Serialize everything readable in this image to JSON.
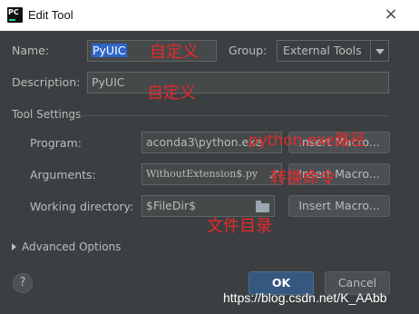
{
  "window": {
    "title": "Edit Tool",
    "app_icon_text": "PC",
    "close_glyph": "×"
  },
  "form": {
    "name_label": "Name:",
    "name_value": "PyUIC",
    "group_label": "Group:",
    "group_value": "External Tools",
    "description_label": "Description:",
    "description_value": "PyUIC"
  },
  "tool_settings": {
    "section_label": "Tool Settings",
    "program_label": "Program:",
    "program_value": "aconda3\\python.exe",
    "arguments_label": "Arguments:",
    "arguments_value": "WithoutExtension$.py",
    "working_dir_label": "Working directory:",
    "working_dir_value": "$FileDir$",
    "insert_macro_label": "Insert Macro..."
  },
  "advanced": {
    "label": "Advanced Options"
  },
  "footer": {
    "help_glyph": "?",
    "ok_label": "OK",
    "cancel_label": "Cancel"
  },
  "annotations": {
    "name_note": "自定义",
    "description_note": "自定义",
    "program_note": "python.exe路径",
    "arguments_note": "转换命令",
    "working_dir_note": "文件目录",
    "watermark": "https://blog.csdn.net/K_AAbb"
  },
  "icons": {
    "app": "pycharm-logo-icon",
    "close": "close-icon",
    "combo": "chevron-down-icon",
    "folder": "folder-icon",
    "expand": "expand-arrows-icon",
    "advanced": "chevron-right-icon",
    "help": "help-icon"
  },
  "colors": {
    "dialog_bg": "#3c3f41",
    "field_bg": "#45494a",
    "selection": "#2f65ca",
    "primary_button": "#365880",
    "annotation_red": "#e8292b"
  }
}
